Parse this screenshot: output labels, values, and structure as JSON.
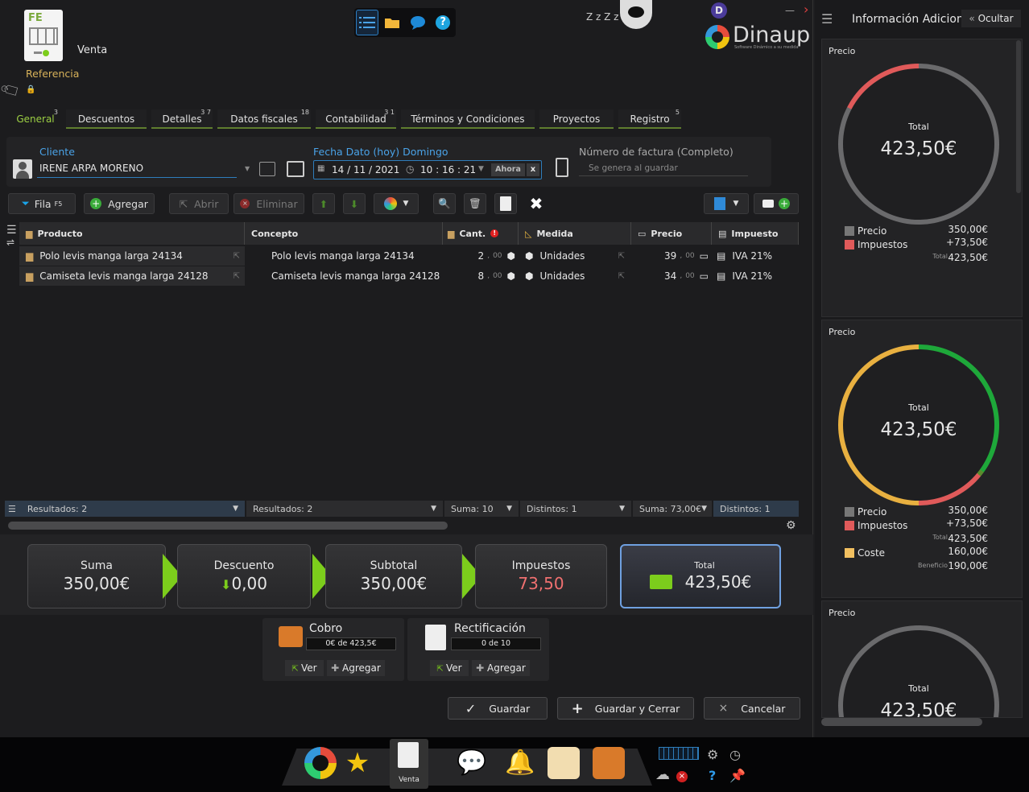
{
  "window": {
    "doc_type": "Venta",
    "reference_label": "Referencia",
    "brand": "Dinaup",
    "brand_tagline": "Software Dinámico a su medida",
    "user_initial": "D",
    "sleep_text": "Z z Z z"
  },
  "tabs": [
    {
      "label": "General",
      "badge": "3"
    },
    {
      "label": "Descuentos",
      "badge": ""
    },
    {
      "label": "Detalles",
      "badge": "3 7"
    },
    {
      "label": "Datos fiscales",
      "badge": "18"
    },
    {
      "label": "Contabilidad",
      "badge": "3 1"
    },
    {
      "label": "Términos y Condiciones",
      "badge": ""
    },
    {
      "label": "Proyectos",
      "badge": ""
    },
    {
      "label": "Registro",
      "badge": "5"
    }
  ],
  "fields": {
    "client_label": "Cliente",
    "client_value": "IRENE ARPA MORENO",
    "date_label": "Fecha Dato (hoy) Domingo",
    "date_value": "14 / 11 / 2021",
    "time_value": "10 : 16 : 21",
    "now_label": "Ahora",
    "clear_label": "x",
    "invoice_label": "Número de factura (Completo)",
    "invoice_placeholder": "Se genera al guardar"
  },
  "toolbar": {
    "row_label": "Fila",
    "row_key": "F5",
    "add_label": "Agregar",
    "open_label": "Abrir",
    "delete_label": "Eliminar"
  },
  "grid": {
    "headers": {
      "product": "Producto",
      "concept": "Concepto",
      "qty": "Cant.",
      "measure": "Medida",
      "price": "Precio",
      "tax": "Impuesto"
    },
    "rows": [
      {
        "product": "Polo levis manga larga 24134",
        "concept": "Polo levis manga larga 24134",
        "qty": "2",
        "qty_dec": "00",
        "measure": "Unidades",
        "price": "39",
        "price_dec": "00",
        "tax": "IVA 21%"
      },
      {
        "product": "Camiseta levis manga larga 24128",
        "concept": "Camiseta levis manga larga 24128",
        "qty": "8",
        "qty_dec": "00",
        "measure": "Unidades",
        "price": "34",
        "price_dec": "00",
        "tax": "IVA 21%"
      }
    ],
    "footer": {
      "results1": "Resultados: 2",
      "results2": "Resultados: 2",
      "qty_sum": "Suma: 10",
      "distinct1": "Distintos: 1",
      "price_sum": "Suma: 73,00€",
      "distinct2": "Distintos: 1"
    }
  },
  "summary": {
    "suma_label": "Suma",
    "suma_value": "350,00€",
    "descuento_label": "Descuento",
    "descuento_value": "0,00",
    "subtotal_label": "Subtotal",
    "subtotal_value": "350,00€",
    "impuestos_label": "Impuestos",
    "impuestos_value": "73,50",
    "total_label": "Total",
    "total_value": "423,50€"
  },
  "cobro": {
    "title": "Cobro",
    "progress": "0€ de 423,5€",
    "view": "Ver",
    "add": "Agregar"
  },
  "rectificacion": {
    "title": "Rectificación",
    "progress": "0 de 10",
    "view": "Ver",
    "add": "Agregar"
  },
  "actions": {
    "save": "Guardar",
    "save_close": "Guardar y Cerrar",
    "cancel": "Cancelar"
  },
  "panel": {
    "title": "Información Adiciona",
    "hide": "Ocultar",
    "cards": [
      {
        "label": "Precio",
        "total_label": "Total",
        "total": "423,50€"
      },
      {
        "label": "Precio",
        "total_label": "Total",
        "total": "423,50€"
      },
      {
        "label": "Precio",
        "total_label": "Total",
        "total": "423,50€"
      }
    ],
    "legend": {
      "precio": "Precio",
      "precio_val": "350,00€",
      "impuestos": "Impuestos",
      "impuestos_val": "+73,50€",
      "total_small": "Total",
      "total_val": "423,50€",
      "coste": "Coste",
      "coste_val": "160,00€",
      "beneficio": "Beneficio",
      "beneficio_val": "190,00€"
    }
  },
  "taskbar": {
    "active_label": "Venta"
  },
  "colors": {
    "accent_green": "#7ccd1c",
    "accent_blue": "#4aa3e8",
    "impuestos_red": "#e05a5a"
  }
}
